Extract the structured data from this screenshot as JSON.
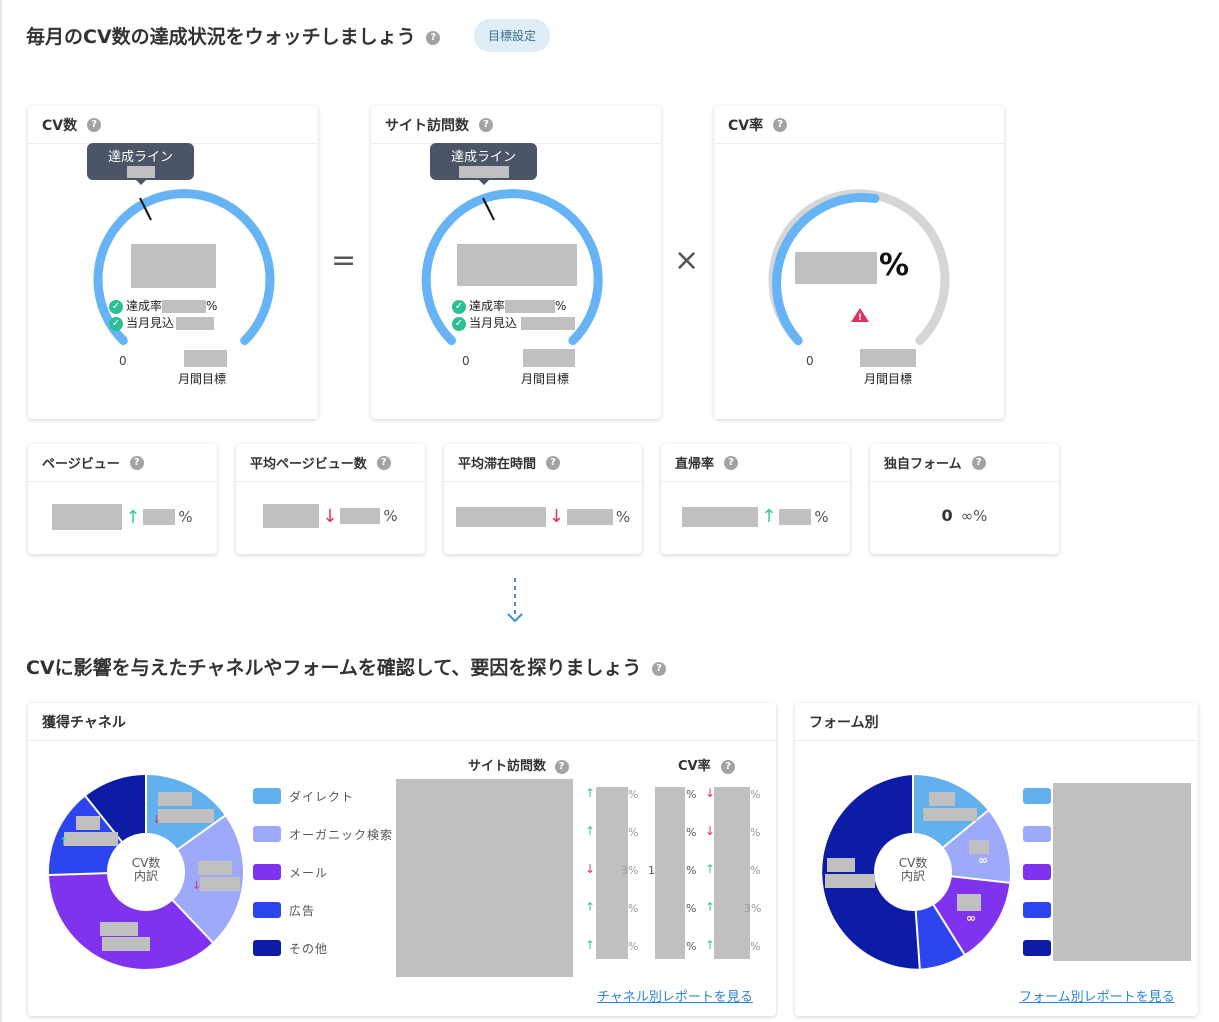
{
  "header": {
    "title": "毎月のCV数の達成状況をウォッチしましょう",
    "goal_button": "目標設定"
  },
  "kpi": {
    "cv": {
      "title": "CV数",
      "tooltip": "達成ライン",
      "achieve_label": "達成率",
      "achieve_suffix": "%",
      "forecast_label": "当月見込",
      "zero": "0",
      "target_label": "月間目標"
    },
    "visits": {
      "title": "サイト訪問数",
      "tooltip": "達成ライン",
      "achieve_label": "達成率",
      "achieve_suffix": "%",
      "forecast_label": "当月見込",
      "zero": "0",
      "target_label": "月間目標"
    },
    "cvr": {
      "title": "CV率",
      "suffix": "%",
      "zero": "0",
      "target_label": "月間目標"
    },
    "equals": "=",
    "times": "×"
  },
  "metrics": [
    {
      "label": "ページビュー",
      "trend": "up",
      "suffix": "%"
    },
    {
      "label": "平均ページビュー数",
      "trend": "down",
      "suffix": "%"
    },
    {
      "label": "平均滞在時間",
      "trend": "down",
      "suffix": "%"
    },
    {
      "label": "直帰率",
      "trend": "up",
      "suffix": "%"
    },
    {
      "label": "独自フォーム",
      "value": "0",
      "change": "∞%"
    }
  ],
  "section2": {
    "title": "CVに影響を与えたチャネルやフォームを確認して、要因を探りましょう"
  },
  "channels": {
    "title": "獲得チャネル",
    "center_label": [
      "CV数",
      "内訳"
    ],
    "legend": [
      {
        "label": "ダイレクト",
        "color": "#63b0ef"
      },
      {
        "label": "オーガニック検索",
        "color": "#9daaf9"
      },
      {
        "label": "メール",
        "color": "#8033ef"
      },
      {
        "label": "広告",
        "color": "#2c45ef"
      },
      {
        "label": "その他",
        "color": "#0c1ca6"
      }
    ],
    "col_visits": "サイト訪問数",
    "col_cvr": "CV率",
    "rows": [
      {
        "v_trend": "up",
        "v_pct": "%",
        "c_mid": "%",
        "c_trend": "down",
        "c_pct": "%"
      },
      {
        "v_trend": "up",
        "v_pct": "%",
        "c_mid": "%",
        "c_trend": "down",
        "c_pct": "%"
      },
      {
        "v_trend": "down",
        "v_pct": "3%",
        "c_pre": "1",
        "c_mid": "%",
        "c_trend": "up",
        "c_pct": "%"
      },
      {
        "v_trend": "up",
        "v_pct": "%",
        "c_mid": "%",
        "c_trend": "up",
        "c_pct": "3%"
      },
      {
        "v_trend": "up",
        "v_pct": "%",
        "c_mid": "%",
        "c_trend": "up",
        "c_pct": "%"
      }
    ],
    "report_link": "チャネル別レポートを見る"
  },
  "forms": {
    "title": "フォーム別",
    "center_label": [
      "CV数",
      "内訳"
    ],
    "infinity": "∞",
    "legend_colors": [
      "#63b0ef",
      "#9daaf9",
      "#8033ef",
      "#2c45ef",
      "#0c1ca6"
    ],
    "report_link": "フォーム別レポートを見る"
  }
}
